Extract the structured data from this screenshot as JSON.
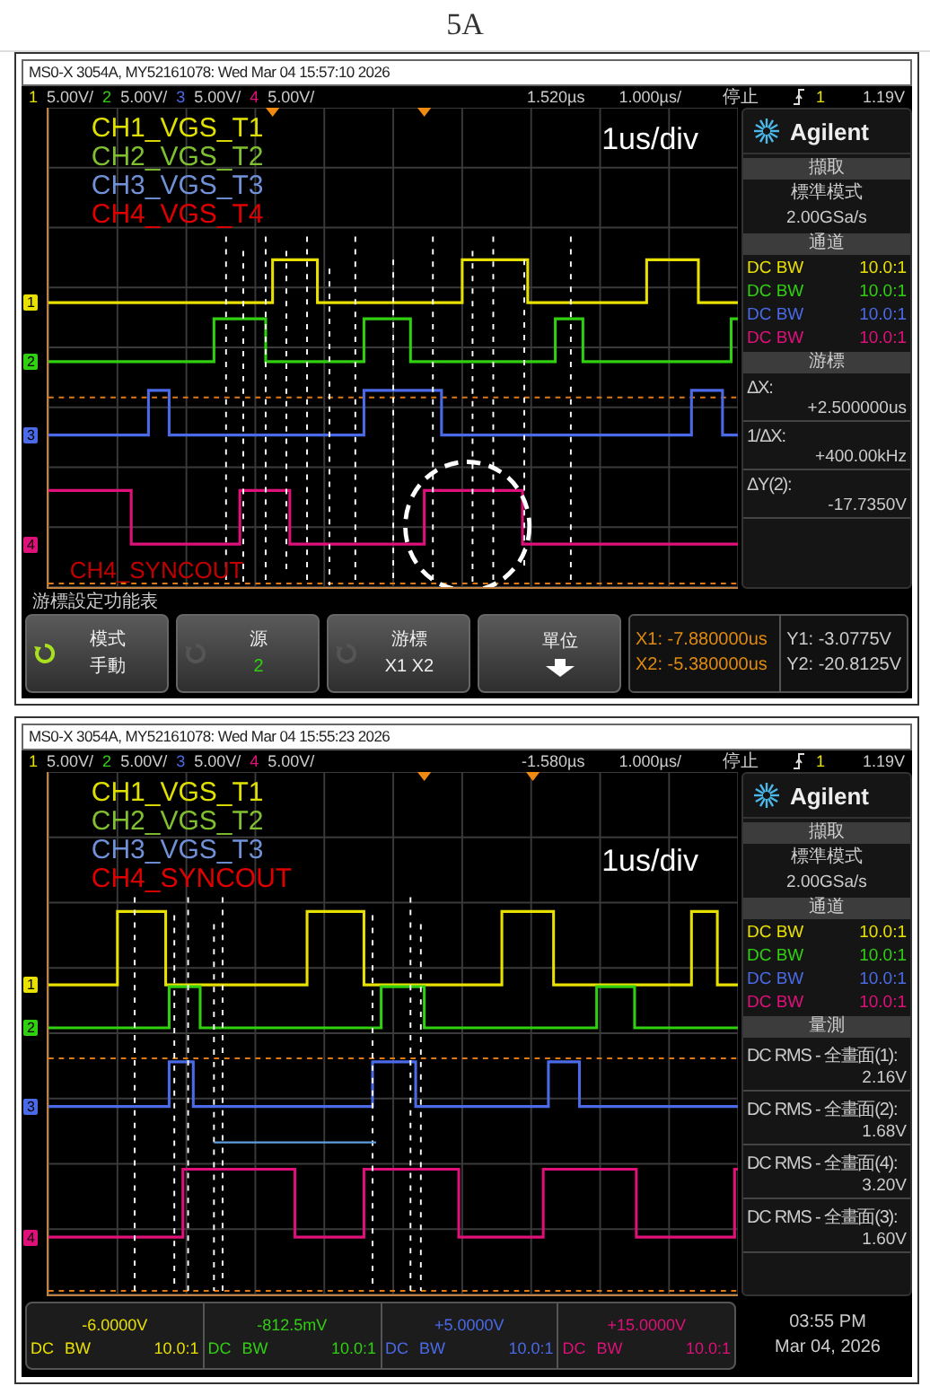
{
  "caption": "5A",
  "scopes": [
    {
      "title": "MS0-X 3054A, MY52161078: Wed Mar 04 15:57:10 2026",
      "channels": [
        {
          "number": "1",
          "scale": "5.00V/",
          "color": "#e8e000"
        },
        {
          "number": "2",
          "scale": "5.00V/",
          "color": "#30d010"
        },
        {
          "number": "3",
          "scale": "5.00V/",
          "color": "#4a6ae8"
        },
        {
          "number": "4",
          "scale": "5.00V/",
          "color": "#e0107a"
        }
      ],
      "delay": "1.520µs",
      "timebase": "1.000µs/",
      "run_state": "停止",
      "trigger_source": "1",
      "trigger_level": "1.19V",
      "labels": [
        {
          "text": "CH1_VGS_T1",
          "color": "#e0e000"
        },
        {
          "text": "CH2_VGS_T2",
          "color": "#80c030"
        },
        {
          "text": "CH3_VGS_T3",
          "color": "#7090d8"
        },
        {
          "text": "CH4_VGS_T4",
          "color": "#e00000"
        }
      ],
      "scale_note": "1us/div",
      "bottom_label": {
        "text": "CH4_SYNCOUT",
        "color": "#c00000"
      },
      "ground_markers": [
        "1",
        "2",
        "3",
        "4"
      ],
      "logo": "Agilent",
      "panels": [
        {
          "kind": "acquire",
          "heading": "擷取",
          "lines": [
            "標準模式",
            "2.00GSa/s"
          ]
        },
        {
          "kind": "channels",
          "heading": "通道",
          "rows": [
            {
              "coupling": "DC BW",
              "probe": "10.0:1"
            },
            {
              "coupling": "DC BW",
              "probe": "10.0:1"
            },
            {
              "coupling": "DC BW",
              "probe": "10.0:1"
            },
            {
              "coupling": "DC BW",
              "probe": "10.0:1"
            }
          ]
        },
        {
          "kind": "readouts",
          "heading": "游標",
          "items": [
            {
              "label": "ΔX:",
              "value": "+2.500000us"
            },
            {
              "label": "1/ΔX:",
              "value": "+400.00kHz"
            },
            {
              "label": "ΔY(2):",
              "value": "-17.7350V"
            }
          ]
        }
      ],
      "footer": {
        "kind": "softkeys",
        "menu_title": "游標設定功能表",
        "softkeys": [
          {
            "title": "模式",
            "value": "手動",
            "knob_active": true,
            "kind": "text"
          },
          {
            "title": "源",
            "value": "2",
            "color": "#30d010",
            "knob_active": false,
            "kind": "text"
          },
          {
            "title": "游標",
            "value": "X1 X2",
            "knob_active": false,
            "kind": "text"
          },
          {
            "title": "單位",
            "kind": "arrow"
          }
        ],
        "x_readouts": [
          "X1: -7.880000us",
          "X2: -5.380000us"
        ],
        "y_readouts": [
          "Y1: -3.0775V",
          "Y2: -20.8125V"
        ]
      }
    },
    {
      "title": "MS0-X 3054A, MY52161078: Wed Mar 04 15:55:23 2026",
      "channels": [
        {
          "number": "1",
          "scale": "5.00V/",
          "color": "#e8e000"
        },
        {
          "number": "2",
          "scale": "5.00V/",
          "color": "#30d010"
        },
        {
          "number": "3",
          "scale": "5.00V/",
          "color": "#4a6ae8"
        },
        {
          "number": "4",
          "scale": "5.00V/",
          "color": "#e0107a"
        }
      ],
      "delay": "-1.580µs",
      "timebase": "1.000µs/",
      "run_state": "停止",
      "trigger_source": "1",
      "trigger_level": "1.19V",
      "labels": [
        {
          "text": "CH1_VGS_T1",
          "color": "#e0e000"
        },
        {
          "text": "CH2_VGS_T2",
          "color": "#80c030"
        },
        {
          "text": "CH3_VGS_T3",
          "color": "#7090d8"
        },
        {
          "text": "CH4_SYNCOUT",
          "color": "#e00000"
        }
      ],
      "scale_note": "1us/div",
      "ground_markers": [
        "1",
        "2",
        "3",
        "4"
      ],
      "logo": "Agilent",
      "panels": [
        {
          "kind": "acquire",
          "heading": "擷取",
          "lines": [
            "標準模式",
            "2.00GSa/s"
          ]
        },
        {
          "kind": "channels",
          "heading": "通道",
          "rows": [
            {
              "coupling": "DC BW",
              "probe": "10.0:1"
            },
            {
              "coupling": "DC BW",
              "probe": "10.0:1"
            },
            {
              "coupling": "DC BW",
              "probe": "10.0:1"
            },
            {
              "coupling": "DC BW",
              "probe": "10.0:1"
            }
          ]
        },
        {
          "kind": "readouts",
          "heading": "量測",
          "items": [
            {
              "label": "DC RMS - 全畫面(1):",
              "value": "2.16V"
            },
            {
              "label": "DC RMS - 全畫面(2):",
              "value": "1.68V"
            },
            {
              "label": "DC RMS - 全畫面(4):",
              "value": "3.20V"
            },
            {
              "label": "DC RMS - 全畫面(3):",
              "value": "1.60V"
            }
          ]
        }
      ],
      "footer": {
        "kind": "offsets",
        "offsets": [
          {
            "offset": "-6.0000V",
            "coupling": "DC",
            "bw": "BW",
            "probe": "10.0:1"
          },
          {
            "offset": "-812.5mV",
            "coupling": "DC",
            "bw": "BW",
            "probe": "10.0:1"
          },
          {
            "offset": "+5.0000V",
            "coupling": "DC",
            "bw": "BW",
            "probe": "10.0:1"
          },
          {
            "offset": "+15.0000V",
            "coupling": "DC",
            "bw": "BW",
            "probe": "10.0:1"
          }
        ],
        "time": "03:55 PM",
        "date": "Mar 04, 2026"
      }
    }
  ]
}
